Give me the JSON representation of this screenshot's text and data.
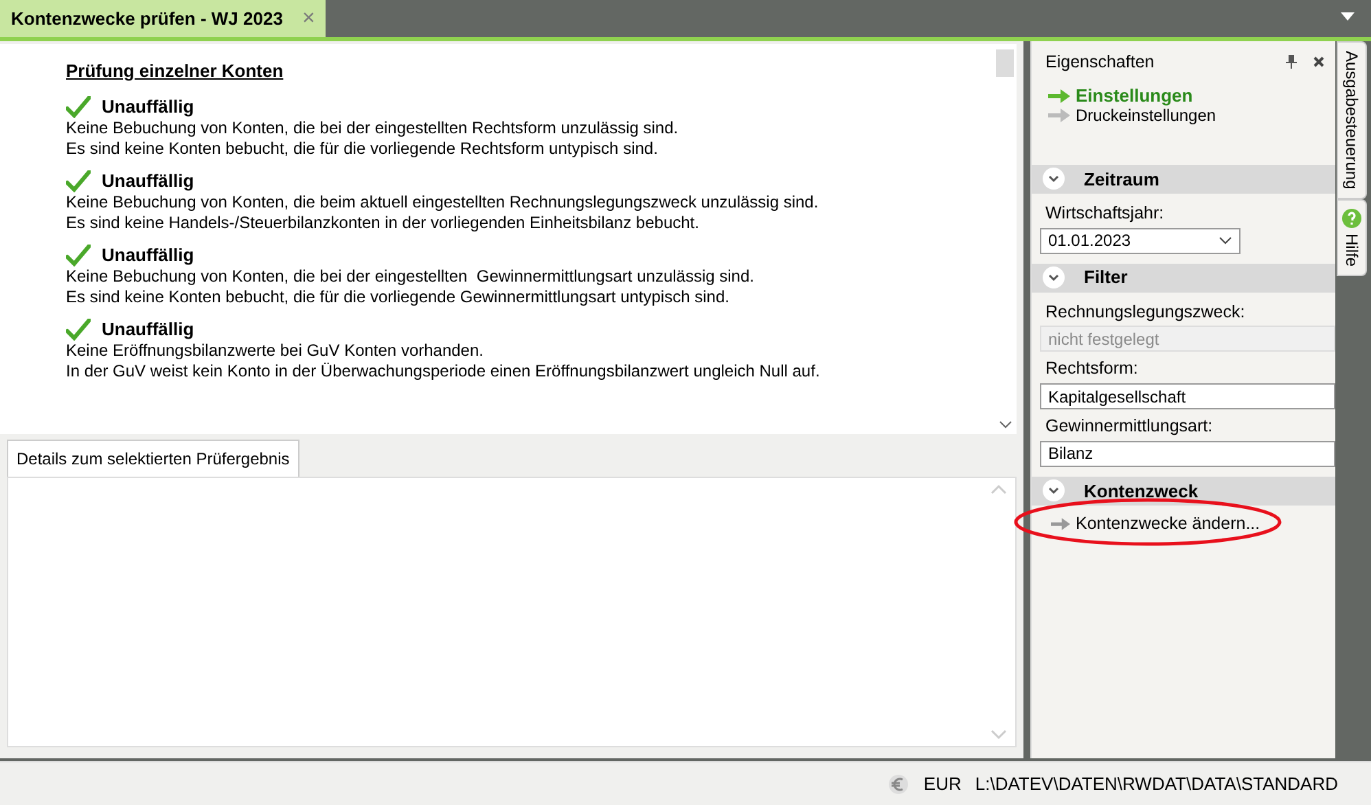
{
  "document_tab": {
    "title": "Kontenzwecke prüfen - WJ 2023",
    "close": "×",
    "selected": true
  },
  "report": {
    "heading": "Prüfung einzelner Konten",
    "results": [
      {
        "status": "Unauffällig",
        "kind": "ok",
        "lines": [
          "Keine Bebuchung von Konten, die bei der eingestellten Rechtsform unzulässig sind.",
          "Es sind keine Konten bebucht, die für die vorliegende Rechtsform untypisch sind."
        ]
      },
      {
        "status": "Unauffällig",
        "kind": "ok",
        "lines": [
          "Keine Bebuchung von Konten, die beim aktuell eingestellten Rechnungslegungszweck unzulässig sind.",
          "Es sind keine Handels-/Steuerbilanzkonten in der vorliegenden Einheitsbilanz bebucht."
        ]
      },
      {
        "status": "Unauffällig",
        "kind": "ok",
        "lines": [
          "Keine Bebuchung von Konten, die bei der eingestellten  Gewinnermittlungsart unzulässig sind.",
          "Es sind keine Konten bebucht, die für die vorliegende Gewinnermittlungsart untypisch sind."
        ]
      },
      {
        "status": "Unauffällig",
        "kind": "ok",
        "lines": [
          "Keine Eröffnungsbilanzwerte bei GuV Konten vorhanden.",
          "In der GuV weist kein Konto in der Überwachungsperiode einen Eröffnungsbilanzwert ungleich Null auf."
        ]
      }
    ]
  },
  "details": {
    "tab": "Details zum selektierten Prüfergebnis",
    "selected": true
  },
  "properties": {
    "title": "Eigenschaften",
    "links": [
      {
        "label": "Einstellungen",
        "selected": true
      },
      {
        "label": "Druckeinstellungen",
        "selected": false
      }
    ],
    "sections": [
      {
        "title": "Zeitraum",
        "fields": [
          {
            "label": "Wirtschaftsjahr:",
            "value": "01.01.2023",
            "kind": "dropdown",
            "disabled": false
          }
        ]
      },
      {
        "title": "Filter",
        "fields": [
          {
            "label": "Rechnungslegungszweck:",
            "value": "nicht festgelegt",
            "kind": "text",
            "disabled": true
          },
          {
            "label": "Rechtsform:",
            "value": "Kapitalgesellschaft",
            "kind": "text",
            "disabled": false
          },
          {
            "label": "Gewinnermittlungsart:",
            "value": "Bilanz",
            "kind": "text",
            "disabled": false
          }
        ]
      },
      {
        "title": "Kontenzweck",
        "action": "Kontenzwecke ändern..."
      }
    ]
  },
  "side_tabs": [
    {
      "label": "Ausgabesteuerung",
      "kind": "text"
    },
    {
      "label": "Hilfe",
      "kind": "help"
    }
  ],
  "annotation": {
    "kind": "ellipse",
    "color": "#e8101c"
  },
  "status_bar": {
    "currency": "EUR",
    "path": "L:\\DATEV\\DATEN\\RWDAT\\DATA\\STANDARD"
  }
}
